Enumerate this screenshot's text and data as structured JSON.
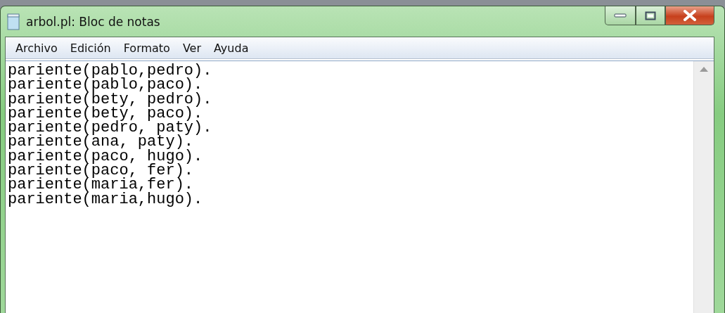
{
  "window": {
    "title": "arbol.pl: Bloc de notas"
  },
  "menu": [
    "Archivo",
    "Edición",
    "Formato",
    "Ver",
    "Ayuda"
  ],
  "editor": {
    "lines": [
      "pariente(pablo,pedro).",
      "pariente(pablo,paco).",
      "pariente(bety, pedro).",
      "pariente(bety, paco).",
      "pariente(pedro, paty).",
      "pariente(ana, paty).",
      "pariente(paco, hugo).",
      "pariente(paco, fer).",
      "pariente(maria,fer).",
      "pariente(maria,hugo)."
    ]
  }
}
